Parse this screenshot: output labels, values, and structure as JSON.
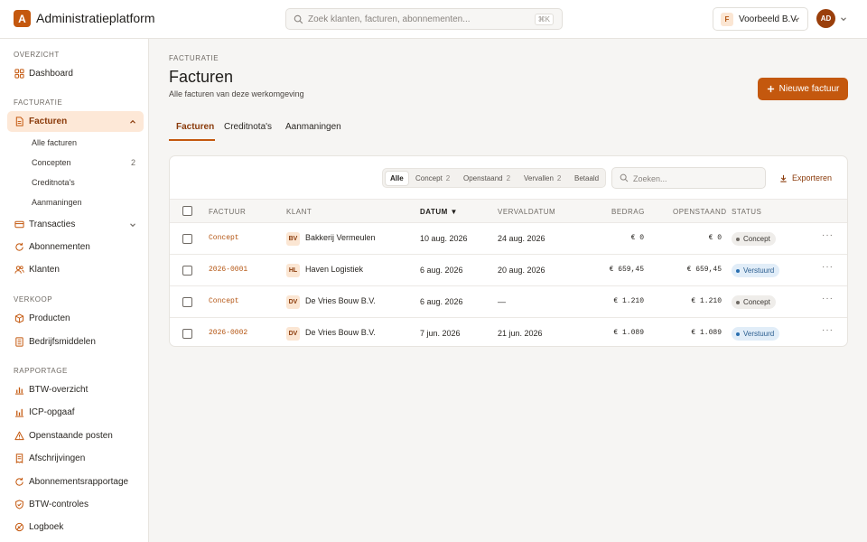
{
  "app": {
    "logo_letter": "A",
    "title": "Administratieplatform"
  },
  "search": {
    "placeholder": "Zoek klanten, facturen, abonnementen...",
    "shortcut": "⌘K"
  },
  "org": {
    "badge": "F",
    "name": "Voorbeeld B.V."
  },
  "user": {
    "initials": "AD"
  },
  "sidebar": {
    "sections": {
      "overview": "OVERZICHT",
      "billing": "FACTURATIE",
      "sales": "VERKOOP",
      "reports": "RAPPORTAGE"
    },
    "items": {
      "dashboard": "Dashboard",
      "facturen": "Facturen",
      "transacties": "Transacties",
      "abonnementen": "Abonnementen",
      "klanten": "Klanten",
      "producten": "Producten",
      "bedrijfsmiddelen": "Bedrijfsmiddelen",
      "btw_overzicht": "BTW-overzicht",
      "icp": "ICP-opgaaf",
      "openstaande": "Openstaande posten",
      "afschrijvingen": "Afschrijvingen",
      "abonnementsrapportage": "Abonnementsrapportage",
      "btw_controles": "BTW-controles",
      "logboek": "Logboek"
    },
    "sub": {
      "alle": "Alle facturen",
      "concepten": "Concepten",
      "concepten_count": "2",
      "creditnotas": "Creditnota's",
      "aanmaningen": "Aanmaningen"
    }
  },
  "page": {
    "breadcrumb": "FACTURATIE",
    "title": "Facturen",
    "subtitle": "Alle facturen van deze werkomgeving",
    "new_button": "Nieuwe factuur",
    "tabs": [
      "Facturen",
      "Creditnota's",
      "Aanmaningen"
    ]
  },
  "filters": {
    "segments": [
      {
        "label": "Alle",
        "count": ""
      },
      {
        "label": "Concept",
        "count": "2"
      },
      {
        "label": "Openstaand",
        "count": "2"
      },
      {
        "label": "Vervallen",
        "count": "2"
      },
      {
        "label": "Betaald",
        "count": ""
      }
    ],
    "search_placeholder": "Zoeken...",
    "export_label": "Exporteren"
  },
  "table": {
    "headers": {
      "factuur": "FACTUUR",
      "klant": "KLANT",
      "datum": "DATUM",
      "vervaldatum": "VERVALDATUM",
      "bedrag": "BEDRAG",
      "openstaand": "OPENSTAAND",
      "status": "STATUS"
    },
    "rows": [
      {
        "factuur": "Concept",
        "badge": "BV",
        "klant": "Bakkerij Vermeulen",
        "datum": "10 aug. 2026",
        "vervaldatum": "24 aug. 2026",
        "bedrag": "€ 0",
        "openstaand": "€ 0",
        "status": "Concept"
      },
      {
        "factuur": "2026-0001",
        "badge": "HL",
        "klant": "Haven Logistiek",
        "datum": "6 aug. 2026",
        "vervaldatum": "20 aug. 2026",
        "bedrag": "€ 659,45",
        "openstaand": "€ 659,45",
        "status": "Verstuurd"
      },
      {
        "factuur": "Concept",
        "badge": "DV",
        "klant": "De Vries Bouw B.V.",
        "datum": "6 aug. 2026",
        "vervaldatum": "—",
        "bedrag": "€ 1.210",
        "openstaand": "€ 1.210",
        "status": "Concept"
      },
      {
        "factuur": "2026-0002",
        "badge": "DV",
        "klant": "De Vries Bouw B.V.",
        "datum": "7 jun. 2026",
        "vervaldatum": "21 jun. 2026",
        "bedrag": "€ 1.089",
        "openstaand": "€ 1.089",
        "status": "Verstuurd"
      }
    ]
  },
  "colors": {
    "accent": "#c4580e",
    "accent_soft": "#fde8d7",
    "sent": "#2a6fb0"
  }
}
